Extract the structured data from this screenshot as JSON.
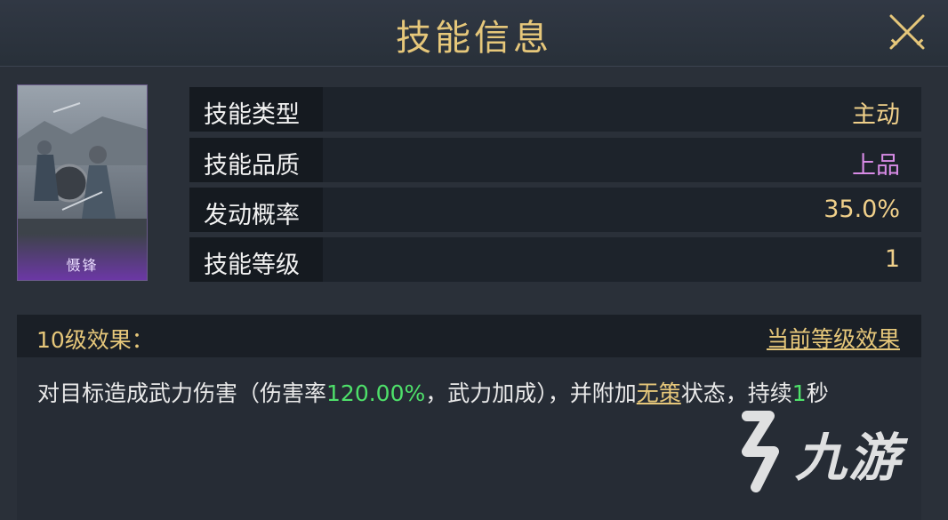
{
  "header": {
    "title": "技能信息"
  },
  "skill_card": {
    "name": "慑锋"
  },
  "info_rows": [
    {
      "label": "技能类型",
      "value": "主动",
      "value_color": "#f0d08a"
    },
    {
      "label": "技能品质",
      "value": "上品",
      "value_color": "#d88be6"
    },
    {
      "label": "发动概率",
      "value": "35.0%",
      "value_color": "#f0d08a"
    },
    {
      "label": "技能等级",
      "value": "1",
      "value_color": "#f0d08a"
    }
  ],
  "effect": {
    "title": "10级效果：",
    "current_level_link": "当前等级效果",
    "desc_part1": "对目标造成武力伤害（伤害率",
    "desc_rate": "120.00%",
    "desc_part2": "，武力加成），并附加",
    "desc_status": "无策",
    "desc_part3": "状态，持续",
    "desc_duration": "1",
    "desc_part4": "秒"
  },
  "watermark": {
    "text": "九游"
  },
  "colors": {
    "gold": "#e6c77a",
    "green": "#4ee06a",
    "purple": "#d88be6"
  }
}
